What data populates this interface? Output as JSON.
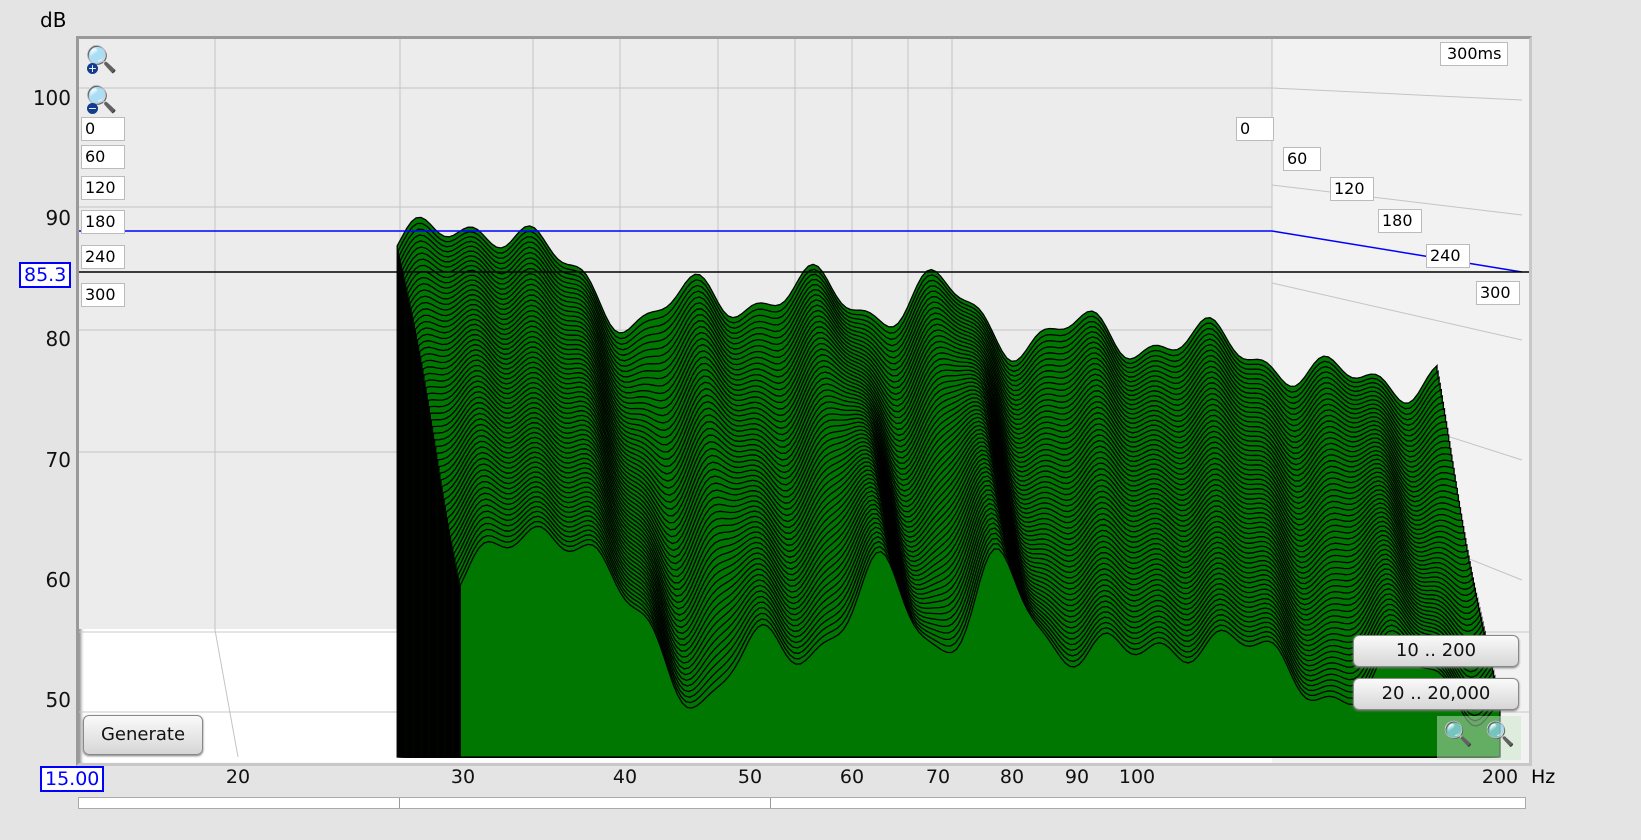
{
  "y_axis": {
    "unit": "dB",
    "ticks": [
      "100",
      "90",
      "80",
      "70",
      "60",
      "50"
    ],
    "cursor_value": "85.3"
  },
  "x_axis": {
    "unit": "Hz",
    "ticks": [
      "20",
      "30",
      "40",
      "50",
      "60",
      "70",
      "80",
      "90",
      "100",
      "200"
    ],
    "start_value": "15.00"
  },
  "time_labels_left": [
    "0",
    "60",
    "120",
    "180",
    "240",
    "300"
  ],
  "time_labels_right": [
    "0",
    "60",
    "120",
    "180",
    "240",
    "300"
  ],
  "time_span": "300ms",
  "buttons": {
    "generate": "Generate",
    "range_low": "10 .. 200",
    "range_full": "20 .. 20,000"
  },
  "colors": {
    "fill": "#007700",
    "cursor": "#0000ff"
  }
}
